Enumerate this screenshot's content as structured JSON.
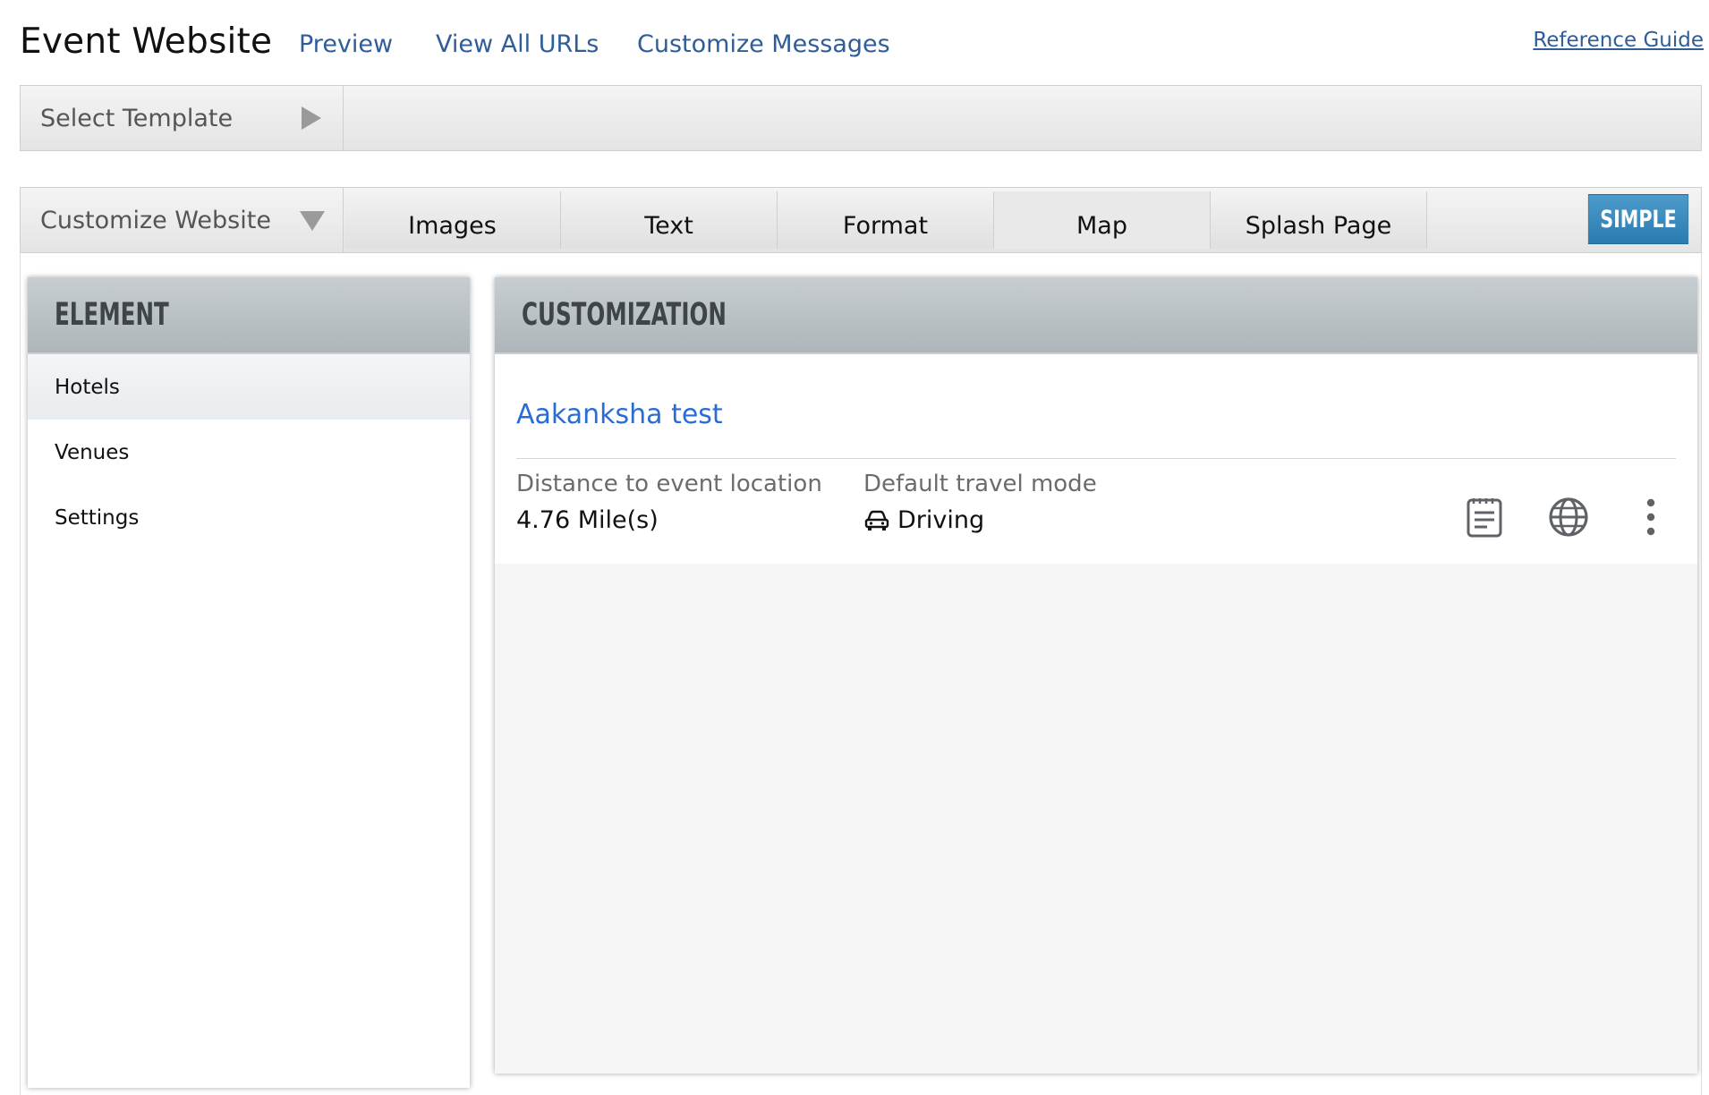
{
  "header": {
    "title": "Event Website",
    "links": [
      "Preview",
      "View All URLs",
      "Customize Messages"
    ],
    "reference_guide": "Reference Guide"
  },
  "template_bar": {
    "label": "Select Template",
    "icon": "triangle-right-icon"
  },
  "customize_bar": {
    "label": "Customize Website",
    "icon": "triangle-down-icon",
    "tabs": [
      "Images",
      "Text",
      "Format",
      "Map",
      "Splash Page"
    ],
    "active_tab": "Map",
    "mode_button": "SIMPLE"
  },
  "element_panel": {
    "heading": "ELEMENT",
    "items": [
      "Hotels",
      "Venues",
      "Settings"
    ],
    "selected": "Hotels"
  },
  "customization_panel": {
    "heading": "CUSTOMIZATION",
    "hotel": {
      "name": "Aakanksha test",
      "distance_label": "Distance to event location",
      "distance_value": "4.76 Mile(s)",
      "travel_label": "Default travel mode",
      "travel_value": "Driving",
      "travel_icon": "car-icon",
      "actions": [
        "notes-icon",
        "globe-icon",
        "more-vertical-icon"
      ]
    }
  },
  "colors": {
    "link": "#2f5d97",
    "hotel_link": "#2a6cd6",
    "simple_button": "#2a7bb0",
    "panel_header": "#b6bec2"
  }
}
